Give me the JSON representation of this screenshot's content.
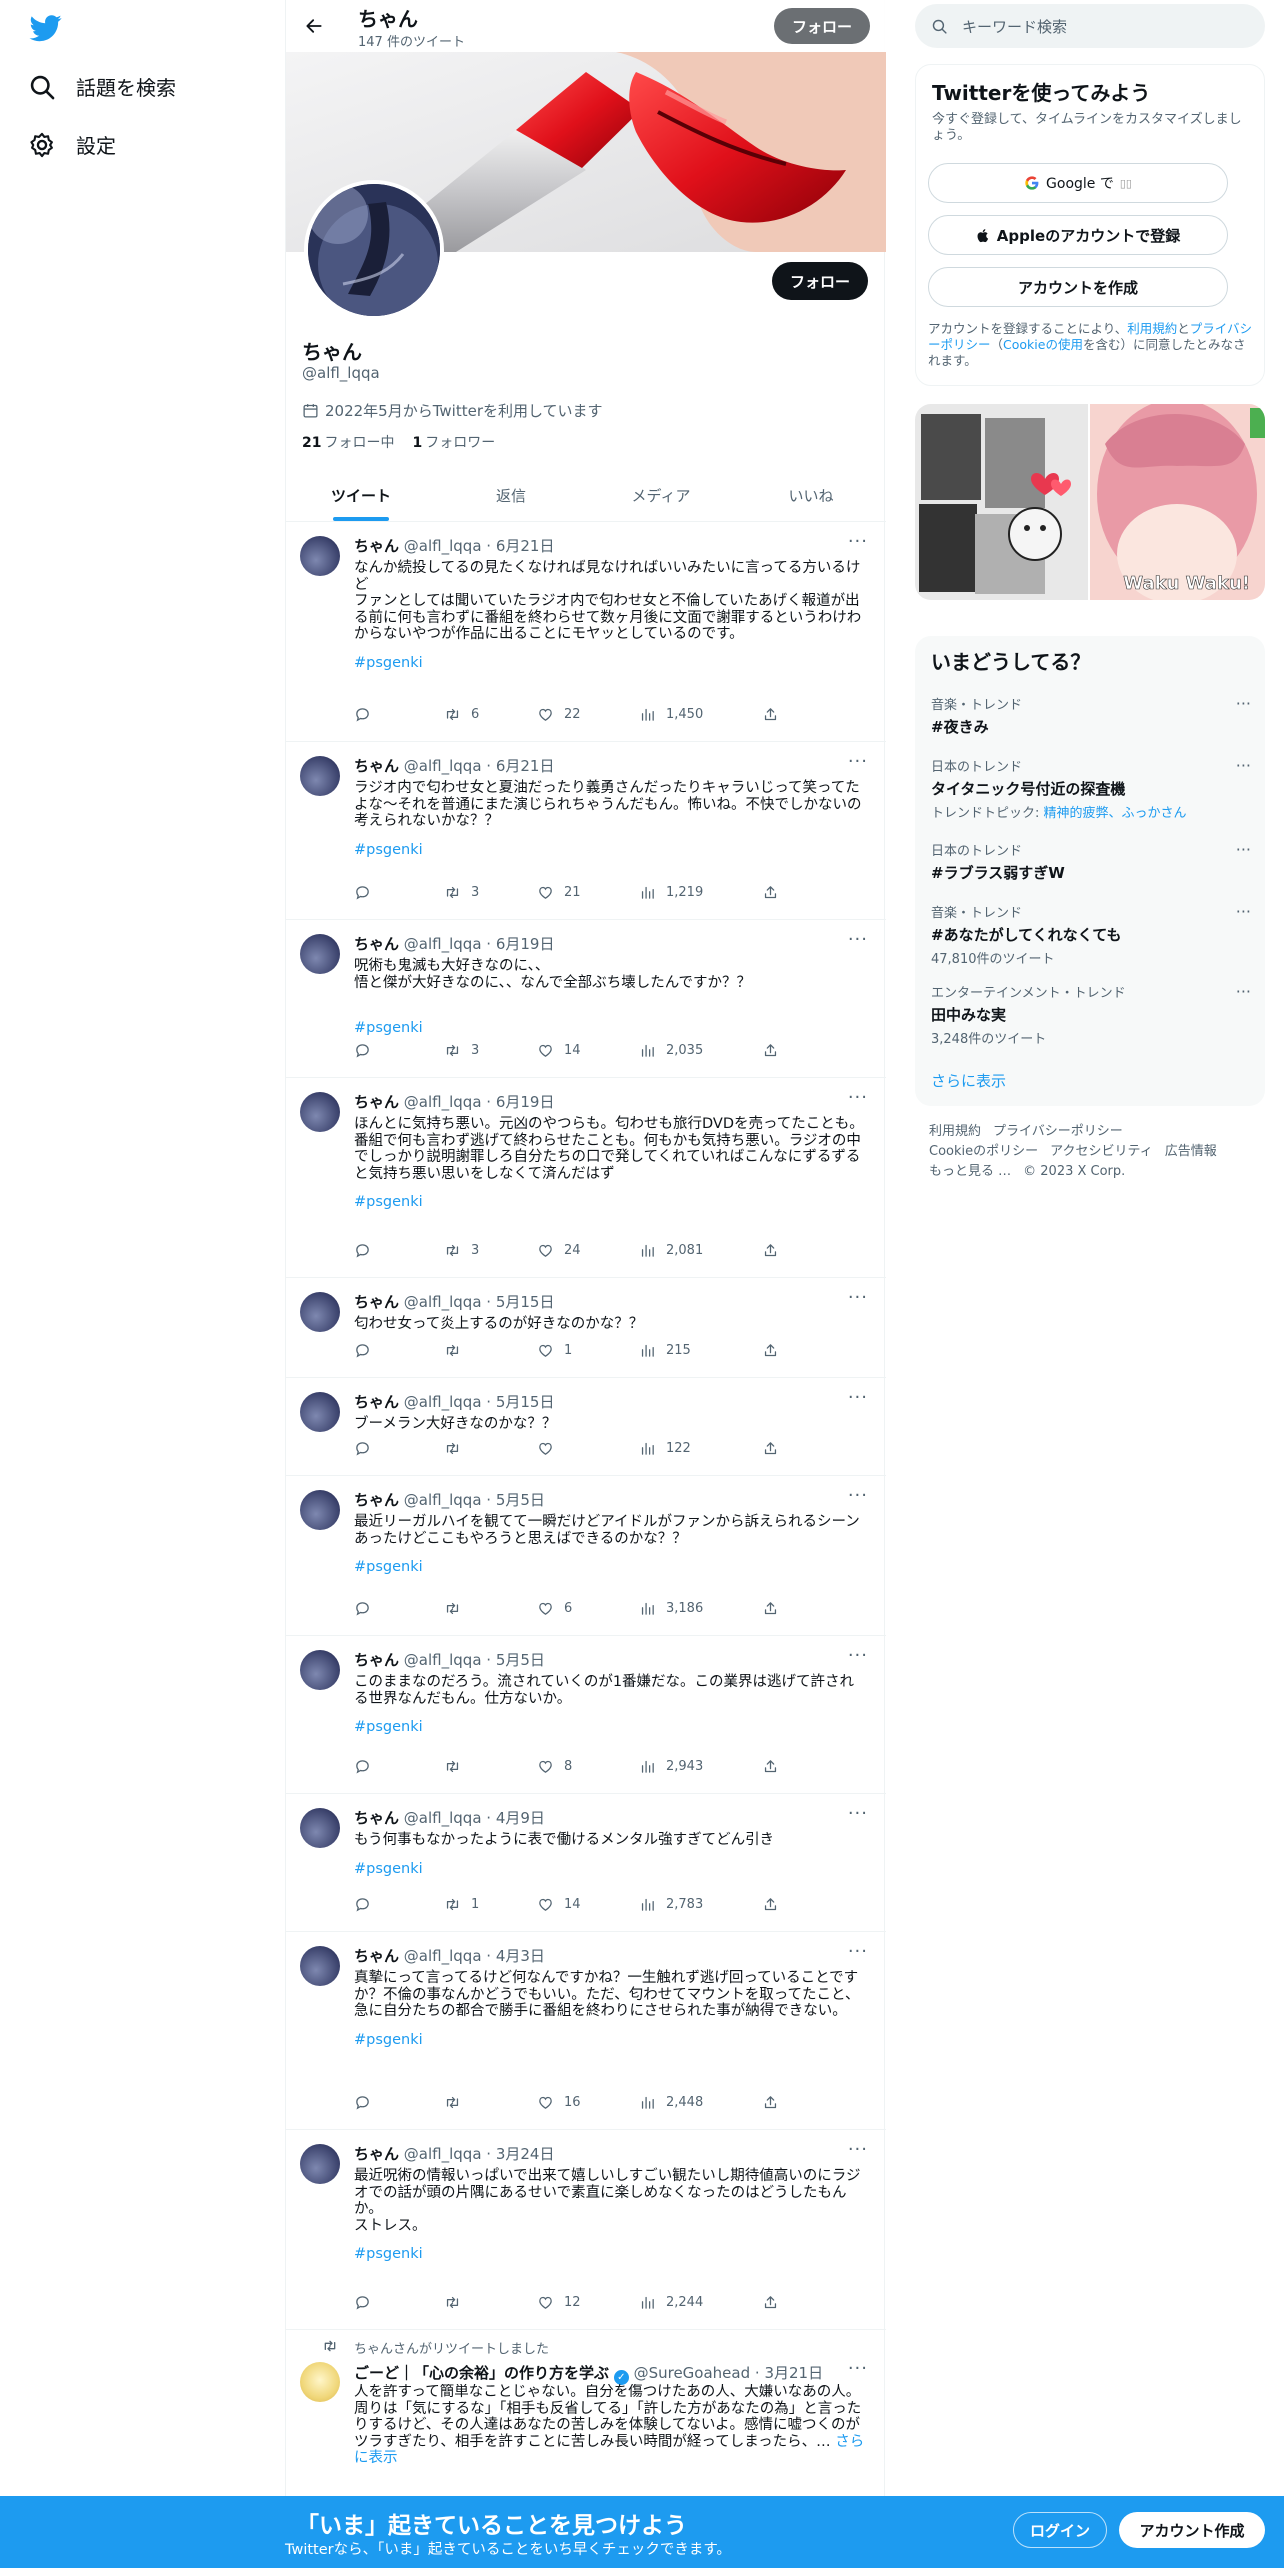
{
  "left_nav": {
    "logo": "twitter-bird-icon",
    "explore": "話題を検索",
    "settings": "設定"
  },
  "header": {
    "name": "ちゃん",
    "tweet_count": "147 件のツイート",
    "follow": "フォロー"
  },
  "profile": {
    "follow": "フォロー",
    "name": "ちゃん",
    "handle": "@alfl_lqqa",
    "joined": "2022年5月からTwitterを利用しています",
    "following_count": "21",
    "following_label": "フォロー中",
    "followers_count": "1",
    "followers_label": "フォロワー"
  },
  "tabs": [
    "ツイート",
    "返信",
    "メディア",
    "いいね"
  ],
  "tweets": [
    {
      "name": "ちゃん",
      "handle": "@alfl_lqqa",
      "date": "6月21日",
      "text": "なんか続投してるの見たくなければ見なければいいみたいに言ってる方いるけど\nファンとしては聞いていたラジオ内で匂わせ女と不倫していたあげく報道が出る前に何も言わずに番組を終わらせて数ヶ月後に文面で謝罪するというわけわからないやつが作品に出ることにモヤッとしているのです。",
      "tag": "#psgenki",
      "retweets": "6",
      "likes": "22",
      "views": "1,450"
    },
    {
      "name": "ちゃん",
      "handle": "@alfl_lqqa",
      "date": "6月21日",
      "text": "ラジオ内で匂わせ女と夏油だったり義勇さんだったりキャラいじって笑ってたよな〜それを普通にまた演じられちゃうんだもん。怖いね。不快でしかないの考えられないかな？？",
      "tag": "#psgenki",
      "retweets": "3",
      "likes": "21",
      "views": "1,219"
    },
    {
      "name": "ちゃん",
      "handle": "@alfl_lqqa",
      "date": "6月19日",
      "text": "呪術も鬼滅も大好きなのに、、\n悟と傑が大好きなのに、、なんで全部ぶち壊したんですか？？",
      "tag": "#psgenki",
      "retweets": "3",
      "likes": "14",
      "views": "2,035"
    },
    {
      "name": "ちゃん",
      "handle": "@alfl_lqqa",
      "date": "6月19日",
      "text": "ほんとに気持ち悪い。元凶のやつらも。匂わせも旅行DVDを売ってたことも。番組で何も言わず逃げて終わらせたことも。何もかも気持ち悪い。ラジオの中でしっかり説明謝罪しろ自分たちの口で発してくれていればこんなにずるずると気持ち悪い思いをしなくて済んだはず",
      "tag": "#psgenki",
      "retweets": "3",
      "likes": "24",
      "views": "2,081"
    },
    {
      "name": "ちゃん",
      "handle": "@alfl_lqqa",
      "date": "5月15日",
      "text": "匂わせ女って炎上するのが好きなのかな？？",
      "tag": "",
      "retweets": "",
      "likes": "1",
      "views": "215"
    },
    {
      "name": "ちゃん",
      "handle": "@alfl_lqqa",
      "date": "5月15日",
      "text": "ブーメラン大好きなのかな？？",
      "tag": "",
      "retweets": "",
      "likes": "",
      "views": "122"
    },
    {
      "name": "ちゃん",
      "handle": "@alfl_lqqa",
      "date": "5月5日",
      "text": "最近リーガルハイを観てて一瞬だけどアイドルがファンから訴えられるシーンあったけどここもやろうと思えばできるのかな？？",
      "tag": "#psgenki",
      "retweets": "",
      "likes": "6",
      "views": "3,186"
    },
    {
      "name": "ちゃん",
      "handle": "@alfl_lqqa",
      "date": "5月5日",
      "text": "このままなのだろう。流されていくのが1番嫌だな。この業界は逃げて許される世界なんだもん。仕方ないか。",
      "tag": "#psgenki",
      "retweets": "",
      "likes": "8",
      "views": "2,943"
    },
    {
      "name": "ちゃん",
      "handle": "@alfl_lqqa",
      "date": "4月9日",
      "text": "もう何事もなかったように表で働けるメンタル強すぎてどん引き",
      "tag": "#psgenki",
      "retweets": "1",
      "likes": "14",
      "views": "2,783"
    },
    {
      "name": "ちゃん",
      "handle": "@alfl_lqqa",
      "date": "4月3日",
      "text": "真摯にって言ってるけど何なんですかね？一生触れず逃げ回っていることですか？不倫の事なんかどうでもいい。ただ、匂わせてマウントを取ってたこと、急に自分たちの都合で勝手に番組を終わりにさせられた事が納得できない。",
      "tag": "#psgenki",
      "retweets": "",
      "likes": "16",
      "views": "2,448"
    },
    {
      "name": "ちゃん",
      "handle": "@alfl_lqqa",
      "date": "3月24日",
      "text": "最近呪術の情報いっぱいで出来て嬉しいしすごい観たいし期待値高いのにラジオでの話が頭の片隅にあるせいで素直に楽しめなくなったのはどうしたもんか。\nストレス。",
      "tag": "#psgenki",
      "retweets": "",
      "likes": "12",
      "views": "2,244"
    }
  ],
  "retweet": {
    "note": "ちゃんさんがリツイートしました",
    "name": "ごーど｜「心の余裕」の作り方を学ぶ",
    "handle": "@SureGoahead",
    "date": "3月21日",
    "text": "人を許すって簡単なことじゃない。自分を傷つけたあの人、大嫌いなあの人。周りは「気にするな」「相手も反省してる」「許した方があなたの為」と言ったりするけど、その人達はあなたの苦しみを体験してないよ。感情に嘘つくのがツラすぎたり、相手を許すことに苦しみ長い時間が経ってしまったら、",
    "more": "さらに表示"
  },
  "sidebar": {
    "search_placeholder": "キーワード検索",
    "signup_title": "Twitterを使ってみよう",
    "signup_sub": "今すぐ登録して、タイムラインをカスタマイズしましょう。",
    "google": "Google で",
    "apple": "Appleのアカウントで登録",
    "create": "アカウントを作成",
    "note_a": "アカウントを登録することにより、",
    "note_terms": "利用規約",
    "note_b": "と",
    "note_privacy": "プライバシーポリシー",
    "note_c": "（",
    "note_cookie": "Cookieの使用",
    "note_d": "を含む）に同意したとみなされます。",
    "media_caption": "Waku Waku!",
    "trends_title": "いまどうしてる？",
    "trends": [
      {
        "cat": "音楽・トレンド",
        "name": "#夜きみ",
        "sub": "",
        "sub_link": ""
      },
      {
        "cat": "日本のトレンド",
        "name": "タイタニック号付近の探査機",
        "sub": "トレンドトピック: ",
        "sub_link": "精神的疲弊、ふっかさん"
      },
      {
        "cat": "日本のトレンド",
        "name": "#ラブラス弱すぎW",
        "sub": "",
        "sub_link": ""
      },
      {
        "cat": "音楽・トレンド",
        "name": "#あなたがしてくれなくても",
        "sub": "47,810件のツイート",
        "sub_link": ""
      },
      {
        "cat": "エンターテインメント・トレンド",
        "name": "田中みな実",
        "sub": "3,248件のツイート",
        "sub_link": ""
      }
    ],
    "show_more": "さらに表示",
    "footer": [
      "利用規約",
      "プライバシーポリシー",
      "Cookieのポリシー",
      "アクセシビリティ",
      "広告情報",
      "もっと見る …",
      "© 2023 X Corp."
    ]
  },
  "bottom_bar": {
    "title": "「いま」起きていることを見つけよう",
    "sub": "Twitterなら、「いま」起きていることをいち早くチェックできます。",
    "login": "ログイン",
    "signup": "アカウント作成"
  },
  "colors": {
    "accent": "#1d9bf0",
    "text": "#0f1419",
    "muted": "#536471"
  }
}
